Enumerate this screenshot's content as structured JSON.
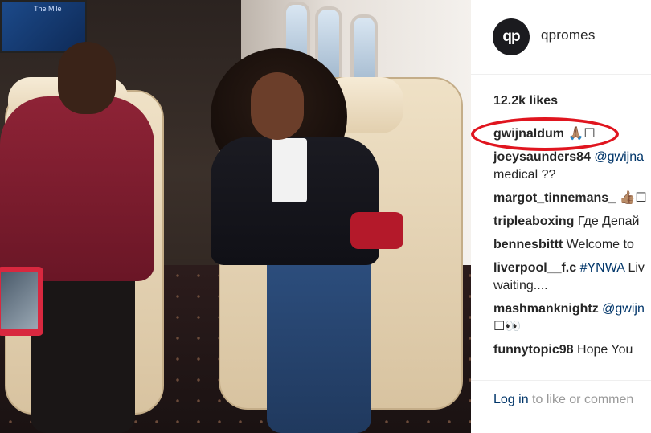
{
  "photo": {
    "alt": "",
    "screen_text": "The Mile"
  },
  "post": {
    "username": "qpromes",
    "avatar_text": "qp",
    "likes": "12.2k likes",
    "comments": [
      {
        "user": "gwijnaldum",
        "text": " 🙏🏽☐"
      },
      {
        "user": "joeysaunders84",
        "text": " ",
        "tag": "@gwijna",
        "line2": "medical ??"
      },
      {
        "user": "margot_tinnemans_",
        "text": " 👍🏽☐"
      },
      {
        "user": "tripleaboxing",
        "text": " Где Депай"
      },
      {
        "user": "bennesbittt",
        "text": " Welcome to"
      },
      {
        "user": "liverpool__f.c",
        "text": " ",
        "tag": "#YNWA",
        "tag_after": " Liv",
        "line2": "waiting...."
      },
      {
        "user": "mashmanknightz",
        "text": " ",
        "tag": "@gwijn",
        "line2": "☐👀"
      },
      {
        "user": "funnytopic98",
        "text": " Hope You"
      }
    ],
    "login_link": "Log in",
    "login_rest": " to like or commen"
  },
  "colors": {
    "highlight": "#e0151f",
    "link": "#003569"
  }
}
